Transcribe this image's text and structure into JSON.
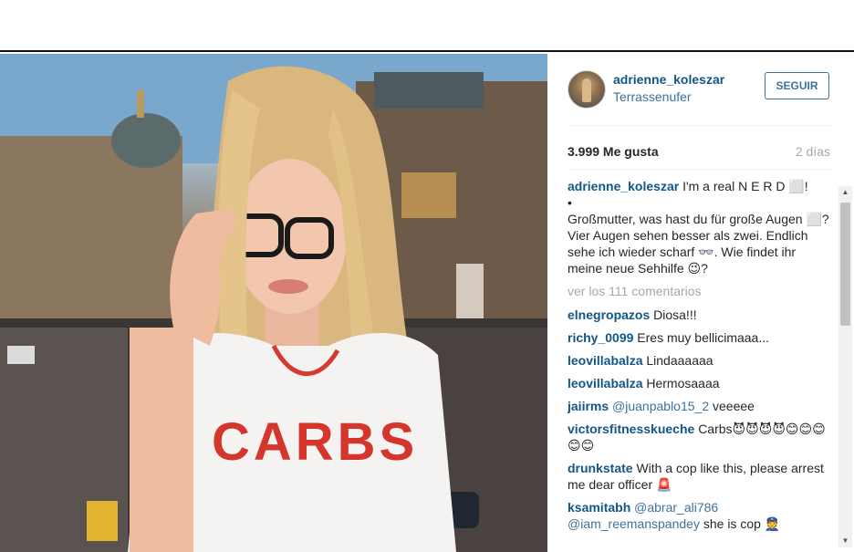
{
  "post": {
    "username": "adrienne_koleszar",
    "location": "Terrassenufer",
    "follow_label": "SEGUIR",
    "likes": "3.999 Me gusta",
    "time": "2 días"
  },
  "caption": {
    "user": "adrienne_koleszar",
    "line1": "I'm a real N E R D ⬜!",
    "bullet": "•",
    "body": "Großmutter, was hast du für große Augen ⬜? Vier Augen sehen besser als zwei. Endlich sehe ich wieder scharf 👓. Wie findet ihr meine neue Sehhilfe 😉?"
  },
  "view_all": "ver los 111 comentarios",
  "comments": [
    {
      "user": "elnegropazos",
      "text": "Diosa!!!"
    },
    {
      "user": "richy_0099",
      "text": "Eres muy bellicimaaa..."
    },
    {
      "user": "leovillabalza",
      "text": "Lindaaaaaa"
    },
    {
      "user": "leovillabalza",
      "text": "Hermosaaaa"
    },
    {
      "user": "jaiirms",
      "mention": "@juanpablo15_2",
      "text": "veeeee"
    },
    {
      "user": "victorsfitnesskueche",
      "text": "Carbs😈😈😈😈😊😊😊😊😊"
    },
    {
      "user": "drunkstate",
      "text": "With a cop like this, please arrest me dear officer 🚨"
    },
    {
      "user": "ksamitabh",
      "mention": "@abrar_ali786",
      "mention2": "@iam_reemanspandey",
      "text": "she is cop 👮"
    }
  ],
  "shirt_text": "CARBS",
  "colors": {
    "link_blue": "#125688",
    "follow_blue": "#3f729b",
    "muted": "#a5a7aa"
  }
}
